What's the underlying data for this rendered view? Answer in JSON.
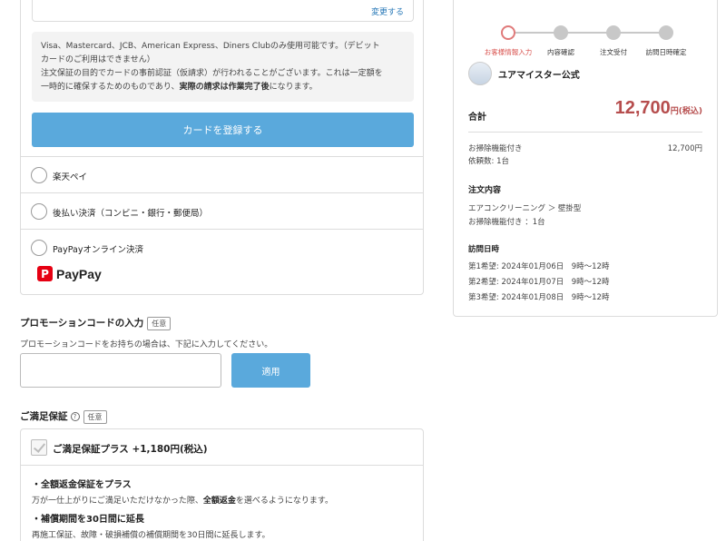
{
  "payment": {
    "change_link": "変更する",
    "notice_line1": "Visa、Mastercard、JCB、American Express、Diners Clubのみ使用可能です。（デビット",
    "notice_line2": "カードのご利用はできません）",
    "notice_line3": "注文保証の目的でカードの事前認証（仮請求）が行われることがございます。これは一定額を",
    "notice_line4_pre": "一時的に確保するためのものであり、",
    "notice_line4_bold": "実際の請求は作業完了後",
    "notice_line4_post": "になります。",
    "register_button": "カードを登録する",
    "options": [
      {
        "label": "楽天ペイ"
      },
      {
        "label": "後払い決済（コンビニ・銀行・郵便局）"
      },
      {
        "label": "PayPayオンライン決済"
      }
    ],
    "paypay_logo_text": "PayPay"
  },
  "promo": {
    "title": "プロモーションコードの入力",
    "optional": "任意",
    "description": "プロモーションコードをお持ちの場合は、下記に入力してください。",
    "input_value": "",
    "apply_button": "適用"
  },
  "guarantee": {
    "title": "ご満足保証",
    "optional": "任意",
    "plan_label": "ご満足保証プラス +1,180円(税込)",
    "item1_title": "・全額返金保証をプラス",
    "item1_desc_pre": "万が一仕上がりにご満足いただけなかった際、",
    "item1_desc_bold": "全額返金",
    "item1_desc_post": "を選べるようになります。",
    "item2_title": "・補償期間を30日間に延長",
    "item2_desc": "再施工保証、故障・破損補償の補償期間を30日間に延長します。"
  },
  "summary": {
    "steps": [
      {
        "label": "お客様情報入力",
        "active": true
      },
      {
        "label": "内容確認",
        "active": false
      },
      {
        "label": "注文受付",
        "active": false
      },
      {
        "label": "訪問日時確定",
        "active": false
      }
    ],
    "shop_name": "ユアマイスター公式",
    "total_label": "合計",
    "total_amount": "12,700",
    "total_tax": "円(税込)",
    "line_item_name": "お掃除機能付き",
    "line_item_price": "12,700円",
    "line_item_qty": "依頼数: 1台",
    "order_heading": "注文内容",
    "order_category": "エアコンクリーニング ＞ 壁掛型",
    "order_detail": "お掃除機能付き ：1台",
    "visit_heading": "訪問日時",
    "visit_1": "第1希望: 2024年01月06日　9時〜12時",
    "visit_2": "第2希望: 2024年01月07日　9時〜12時",
    "visit_3": "第3希望: 2024年01月08日　9時〜12時"
  }
}
